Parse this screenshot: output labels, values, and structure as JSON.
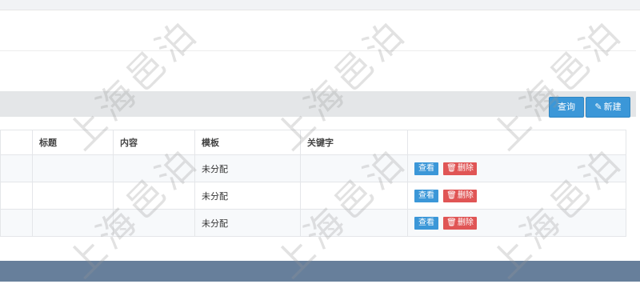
{
  "toolbar": {
    "search_label": "查询",
    "new_label": "新建",
    "new_icon": "pencil-icon"
  },
  "table": {
    "columns": [
      "",
      "标题",
      "内容",
      "模板",
      "关键字",
      ""
    ],
    "rows": [
      {
        "title": "",
        "content": "",
        "template": "未分配",
        "keyword": "",
        "view_label": "查看",
        "delete_label": "删除"
      },
      {
        "title": "",
        "content": "",
        "template": "未分配",
        "keyword": "",
        "view_label": "查看",
        "delete_label": "删除"
      },
      {
        "title": "",
        "content": "",
        "template": "未分配",
        "keyword": "",
        "view_label": "查看",
        "delete_label": "删除"
      }
    ]
  },
  "watermark": {
    "text": "上海邑泊"
  },
  "colors": {
    "primary": "#3b97d8",
    "danger": "#e05555",
    "footer": "#677f9b",
    "toolbar": "#e4e6e8"
  }
}
